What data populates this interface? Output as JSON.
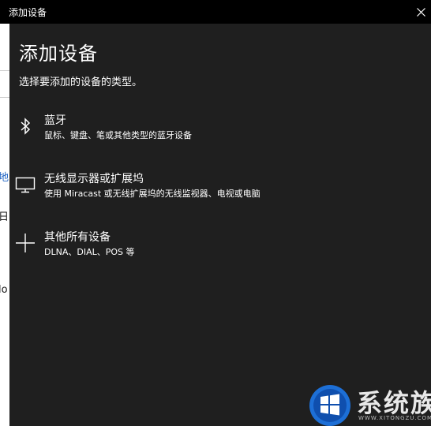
{
  "window": {
    "title": "添加设备"
  },
  "dialog": {
    "heading": "添加设备",
    "subtitle": "选择要添加的设备的类型。",
    "options": [
      {
        "name": "蓝牙",
        "description": "鼠标、键盘、笔或其他类型的蓝牙设备",
        "icon": "bluetooth-icon"
      },
      {
        "name": "无线显示器或扩展坞",
        "description": "使用 Miracast 或无线扩展坞的无线监视器、电视或电脑",
        "icon": "monitor-icon"
      },
      {
        "name": "其他所有设备",
        "description": "DLNA、DIAL、POS 等",
        "icon": "plus-icon"
      }
    ]
  },
  "background": {
    "fragments": [
      "地",
      "日",
      "lo"
    ]
  },
  "watermark": {
    "brand": "系统族",
    "url": "WWW.XITONGZU.COM"
  },
  "colors": {
    "titlebar": "#000000",
    "dialog_bg": "#1f1f1f",
    "text": "#ffffff",
    "watermark_blue": "#1d6fd6"
  }
}
